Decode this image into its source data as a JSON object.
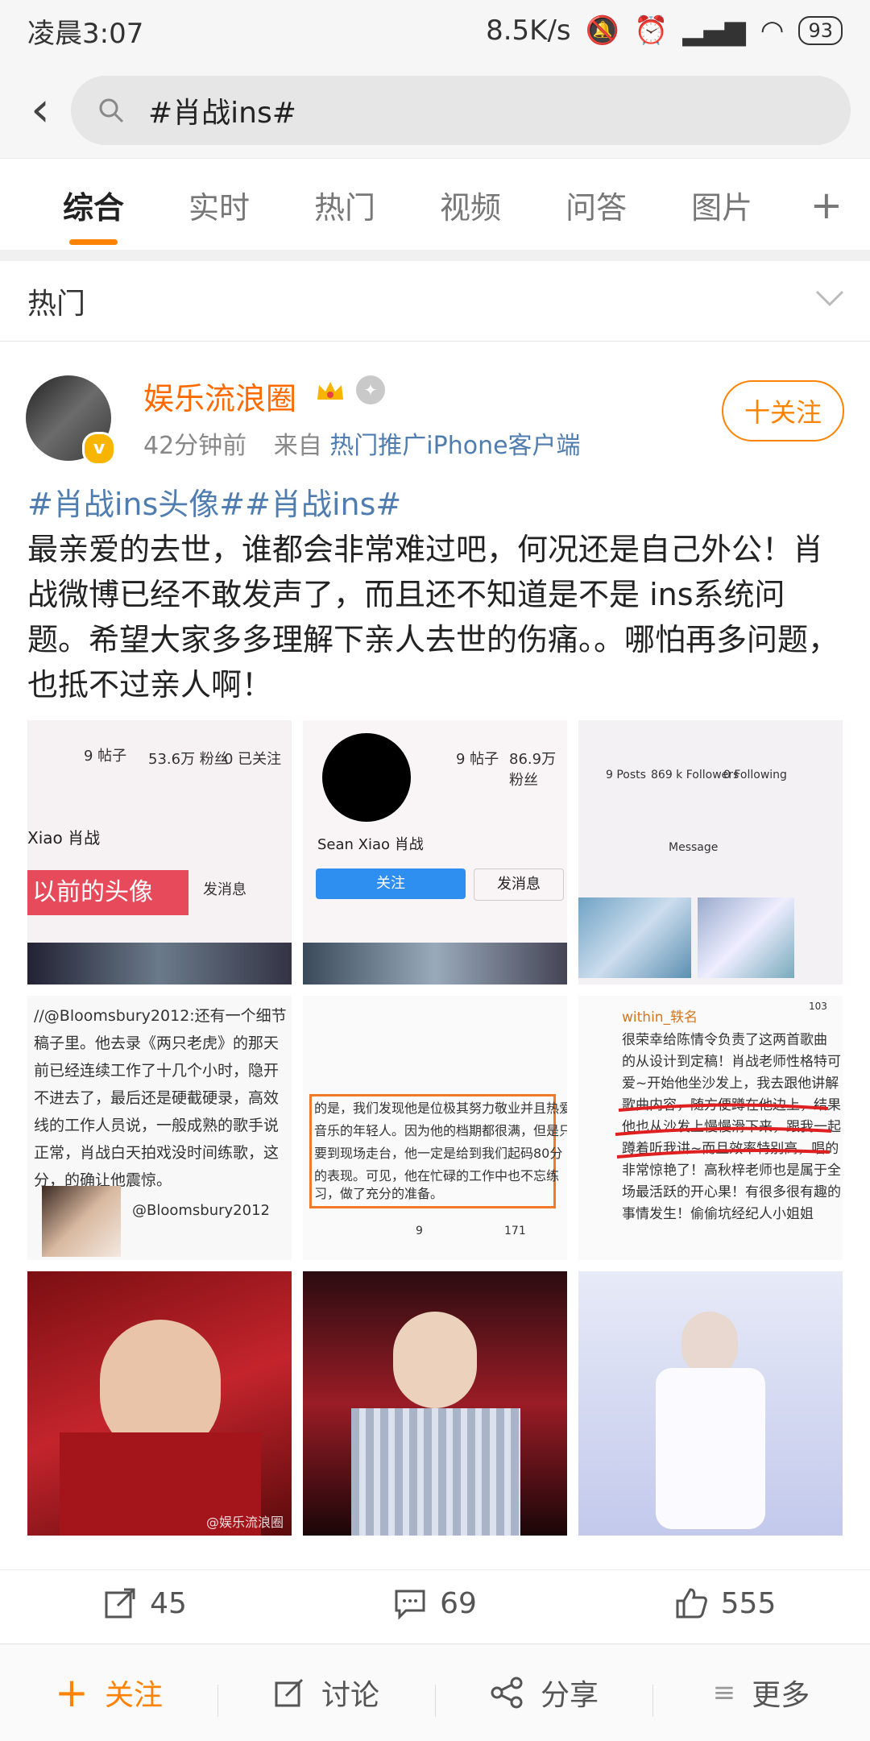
{
  "status": {
    "time": "凌晨3:07",
    "speed": "8.5K/s",
    "battery": "93"
  },
  "search": {
    "query": "#肖战ins#"
  },
  "tabs": [
    "综合",
    "实时",
    "热门",
    "视频",
    "问答",
    "图片"
  ],
  "section": {
    "title": "热门"
  },
  "post": {
    "username": "娱乐流浪圈",
    "time": "42分钟前",
    "from_prefix": "来自",
    "source": "热门推广iPhone客户端",
    "follow_label": "十关注",
    "tags": "#肖战ins头像##肖战ins#",
    "body": "最亲爱的去世，谁都会非常难过吧，何况还是自己外公！肖战微博已经不敢发声了，而且还不知道是不是 ins系统问题。希望大家多多理解下亲人去世的伤痛。。哪怕再多问题，也抵不过亲人啊！",
    "images": [
      {
        "lines": [
          "9 帖子",
          "53.6万 粉丝",
          "0 已关注",
          "Xiao 肖战",
          "以前的头像",
          "发消息"
        ]
      },
      {
        "lines": [
          "9 帖子",
          "86.9万 粉丝",
          "Sean Xiao 肖战",
          "关注",
          "发消息"
        ]
      },
      {
        "lines": [
          "9 Posts",
          "869 k Followers",
          "0 Following",
          "Message"
        ]
      },
      {
        "lines": [
          "//@Bloomsbury2012:还有一个细节",
          "稿子里。他去录《两只老虎》的那天",
          "前已经连续工作了十几个小时，隐开",
          "不进去了，最后还是硬截硬录，高效",
          "线的工作人员说，一般成熟的歌手说",
          "正常，肖战白天拍戏没时间练歌，这",
          "分，的确让他震惊。",
          "@Bloomsbury2012"
        ]
      },
      {
        "lines": [
          "的是，我们发现他是位极其努力敬业并且热爱",
          "音乐的年轻人。因为他的档期都很满，但是只",
          "要到现场走台，他一定是给到我们起码80分",
          "的表现。可见，他在忙碌的工作中也不忘练",
          "习，做了充分的准备。",
          "9",
          "171"
        ]
      },
      {
        "lines": [
          "within_轶名",
          "很荣幸给陈情令负责了这两首歌曲",
          "的从设计到定稿！肖战老师性格特可",
          "爱~开始他坐沙发上，我去跟他讲解",
          "歌曲内容，随方便蹲在他边上，结果",
          "他也从沙发上慢慢滑下来，跟我一起",
          "蹲着听我讲~而且效率特别高，唱的",
          "非常惊艳了！高秋梓老师也是属于全",
          "场最活跃的开心果！有很多很有趣的",
          "事情发生！偷偷坑经纪人小姐姐",
          "103"
        ]
      },
      {
        "lines": [
          "@娱乐流浪圈"
        ]
      },
      {
        "lines": []
      },
      {
        "lines": []
      }
    ]
  },
  "actions": {
    "repost": "45",
    "comment": "69",
    "like": "555"
  },
  "bottom": {
    "follow": "关注",
    "discuss": "讨论",
    "share": "分享",
    "more": "更多"
  }
}
